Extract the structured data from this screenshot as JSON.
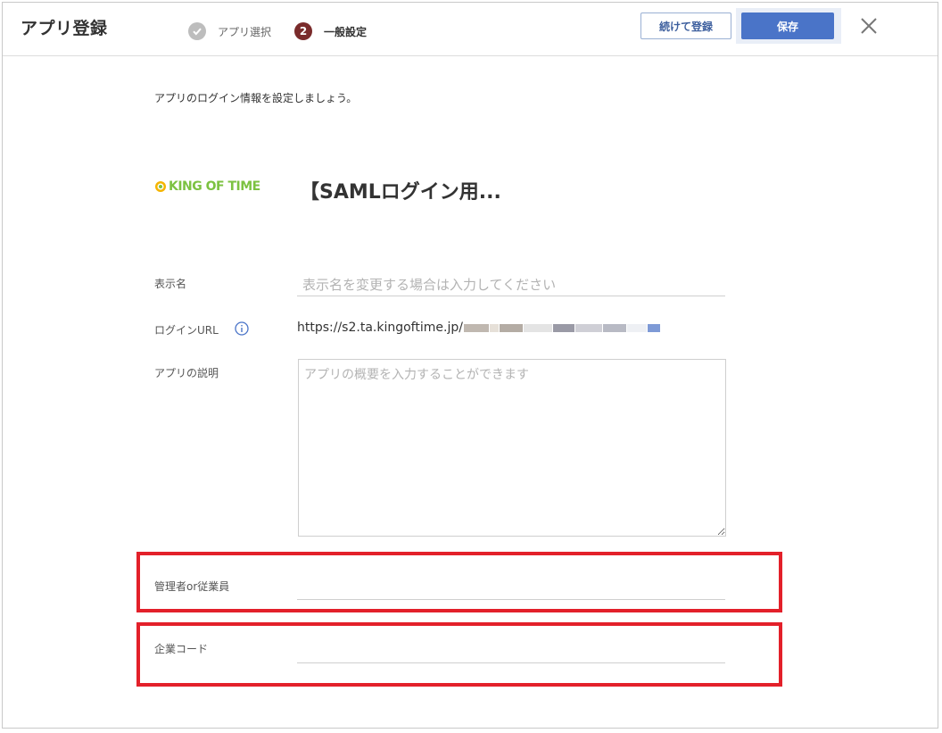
{
  "header": {
    "title": "アプリ登録",
    "steps": [
      {
        "label": "アプリ選択",
        "state": "done"
      },
      {
        "number": "2",
        "label": "一般設定",
        "state": "current"
      }
    ],
    "continue_label": "続けて登録",
    "save_label": "保存"
  },
  "intro": "アプリのログイン情報を設定しましょう。",
  "app": {
    "logo_text": "KING OF TIME",
    "name": "【SAMLログイン用..."
  },
  "form": {
    "display_name": {
      "label": "表示名",
      "placeholder": "表示名を変更する場合は入力してください",
      "value": ""
    },
    "login_url": {
      "label": "ログインURL",
      "value": "https://s2.ta.kingoftime.jp/"
    },
    "description": {
      "label": "アプリの説明",
      "placeholder": "アプリの概要を入力することができます",
      "value": ""
    },
    "role": {
      "label": "管理者or従業員",
      "value": ""
    },
    "company_code": {
      "label": "企業コード",
      "value": ""
    }
  },
  "colors": {
    "accent": "#4a74c8",
    "highlight": "#e3202a",
    "logo_green": "#7cc241",
    "step_current": "#7a2b2b"
  }
}
